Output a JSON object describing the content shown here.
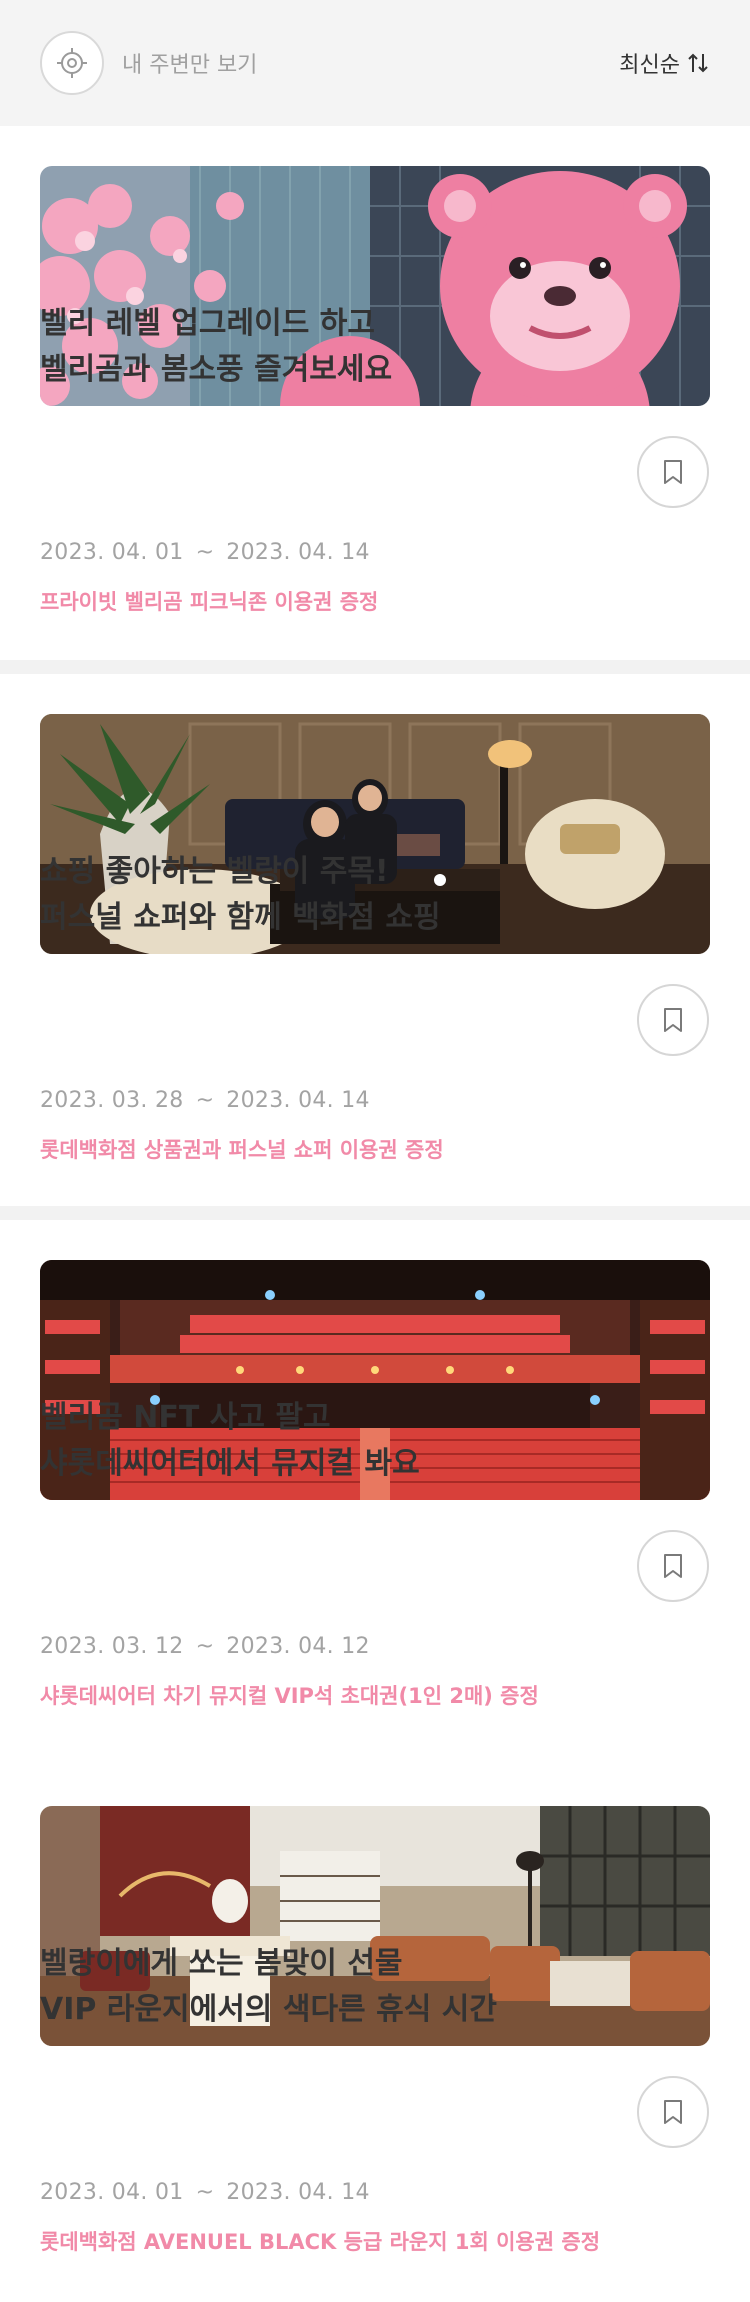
{
  "header": {
    "nearby_label": "내 주변만 보기",
    "sort_label": "최신순"
  },
  "events": [
    {
      "title_line1": "벨리 레벨 업그레이드 하고",
      "title_line2": "벨리곰과 봄소풍 즐겨보세요",
      "start": "2023. 04. 01",
      "end": "2023. 04. 14",
      "benefit": "프라이빗 벨리곰 피크닉존 이용권 증정"
    },
    {
      "title_line1": "쇼핑 좋아하는 벨랑이 주목!",
      "title_line2": "퍼스널 쇼퍼와 함께 백화점 쇼핑",
      "start": "2023. 03. 28",
      "end": "2023. 04. 14",
      "benefit": "롯데백화점 상품권과 퍼스널 쇼퍼 이용권 증정"
    },
    {
      "title_line1": "벨리곰 NFT 사고 팔고",
      "title_line2": "샤롯데씨어터에서 뮤지컬 봐요",
      "start": "2023. 03. 12",
      "end": "2023. 04. 12",
      "benefit": "샤롯데씨어터 차기 뮤지컬 VIP석 초대권(1인 2매) 증정"
    },
    {
      "title_line1": "벨랑이에게 쏘는 봄맞이 선물",
      "title_line2": "VIP 라운지에서의 색다른 휴식 시간",
      "start": "2023. 04. 01",
      "end": "2023. 04. 14",
      "benefit": "롯데백화점 AVENUEL BLACK 등급 라운지 1회 이용권 증정"
    }
  ],
  "date_separator": "~",
  "colors": {
    "accent_pink": "#f18aa8",
    "header_bg": "#f4f4f4",
    "date_gray": "#a3a3a3"
  }
}
